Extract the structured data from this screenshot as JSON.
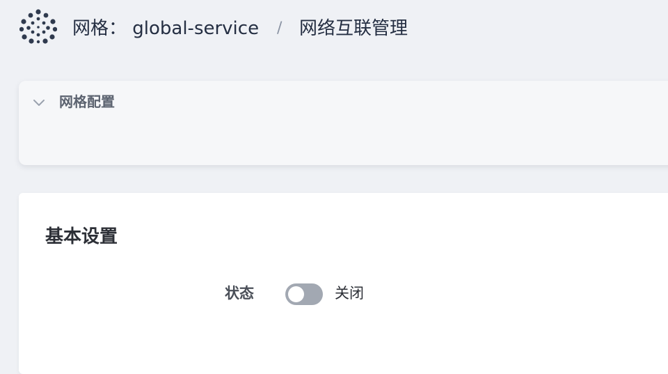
{
  "header": {
    "logo_icon": "mesh-dots-icon",
    "title": "网格： global-service",
    "separator": "/",
    "current": "网络互联管理"
  },
  "mesh_config": {
    "icon": "chevron-down-icon",
    "title": "网格配置",
    "expanded": false
  },
  "basic_settings": {
    "title": "基本设置",
    "status_label": "状态",
    "status_enabled": false,
    "status_text": "关闭"
  },
  "colors": {
    "background": "#eff1f5",
    "text_primary": "#242e42",
    "toggle_off": "#a2a8b2",
    "card_bg": "#ffffff"
  }
}
